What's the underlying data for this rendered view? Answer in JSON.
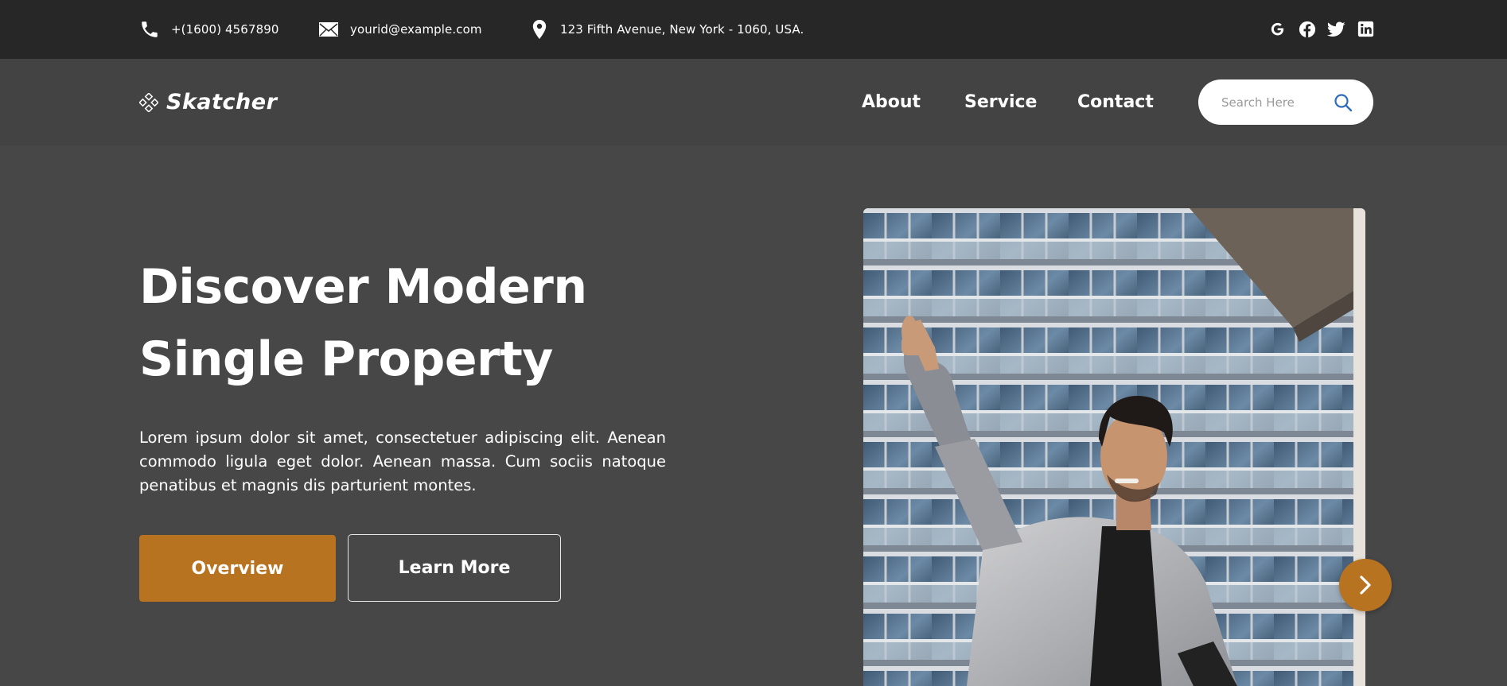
{
  "topbar": {
    "phone": "+(1600) 4567890",
    "email": "yourid@example.com",
    "address": "123 Fifth Avenue, New York - 1060, USA.",
    "socials": [
      "google-icon",
      "facebook-icon",
      "twitter-icon",
      "linkedin-icon"
    ]
  },
  "nav": {
    "logo_text": "Skatcher",
    "links": [
      "About",
      "Service",
      "Contact"
    ],
    "search_placeholder": "Search Here"
  },
  "hero": {
    "title_line1": "Discover Modern",
    "title_line2": "Single Property",
    "description": "Lorem ipsum dolor sit amet, consectetuer adipiscing elit. Aenean commodo ligula eget dolor. Aenean massa. Cum sociis natoque penatibus et magnis dis parturient montes.",
    "primary_button": "Overview",
    "secondary_button": "Learn More"
  },
  "colors": {
    "accent": "#b87320",
    "topbar_bg": "#272727",
    "nav_bg": "#434343",
    "page_bg": "#474747",
    "search_icon": "#2f6db8"
  }
}
